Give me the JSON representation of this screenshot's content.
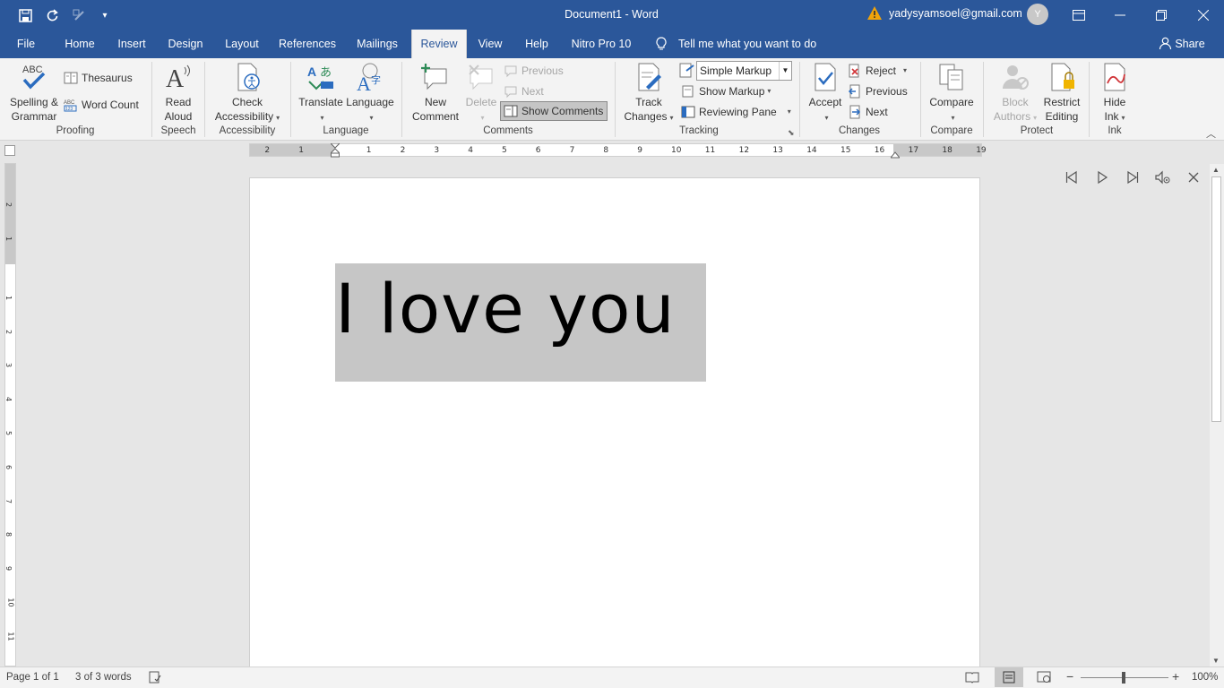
{
  "titlebar": {
    "doc_title": "Document1  -  Word",
    "account": "yadysyamsoel@gmail.com",
    "avatar_initial": "Y"
  },
  "tabs": [
    {
      "label": "File"
    },
    {
      "label": "Home"
    },
    {
      "label": "Insert"
    },
    {
      "label": "Design"
    },
    {
      "label": "Layout"
    },
    {
      "label": "References"
    },
    {
      "label": "Mailings"
    },
    {
      "label": "Review",
      "active": true
    },
    {
      "label": "View"
    },
    {
      "label": "Help"
    },
    {
      "label": "Nitro Pro 10"
    }
  ],
  "tell_me": "Tell me what you want to do",
  "share": "Share",
  "ribbon": {
    "proofing": {
      "spelling": "Spelling &",
      "spelling2": "Grammar",
      "thesaurus": "Thesaurus",
      "word_count": "Word Count",
      "label": "Proofing"
    },
    "speech": {
      "read": "Read",
      "read2": "Aloud",
      "label": "Speech"
    },
    "accessibility": {
      "check": "Check",
      "check2": "Accessibility",
      "label": "Accessibility"
    },
    "language": {
      "translate": "Translate",
      "language": "Language",
      "label": "Language"
    },
    "comments": {
      "new": "New",
      "new2": "Comment",
      "delete": "Delete",
      "previous": "Previous",
      "next": "Next",
      "show": "Show Comments",
      "label": "Comments"
    },
    "tracking": {
      "track": "Track",
      "track2": "Changes",
      "markup": "Simple Markup",
      "show_markup": "Show Markup",
      "reviewing_pane": "Reviewing Pane",
      "label": "Tracking"
    },
    "changes": {
      "accept": "Accept",
      "reject": "Reject",
      "previous": "Previous",
      "next": "Next",
      "label": "Changes"
    },
    "compare": {
      "compare": "Compare",
      "label": "Compare"
    },
    "protect": {
      "block": "Block",
      "block2": "Authors",
      "restrict": "Restrict",
      "restrict2": "Editing",
      "label": "Protect"
    },
    "ink": {
      "hide": "Hide",
      "hide2": "Ink",
      "label": "Ink"
    }
  },
  "ruler_ticks": [
    "2",
    "1",
    "1",
    "2",
    "3",
    "4",
    "5",
    "6",
    "7",
    "8",
    "9",
    "10",
    "11",
    "12",
    "13",
    "14",
    "15",
    "16",
    "17",
    "18",
    "19"
  ],
  "vruler_ticks": [
    "2",
    "1",
    "1",
    "2",
    "3",
    "4",
    "5",
    "6",
    "7",
    "8",
    "9",
    "10",
    "11"
  ],
  "document": {
    "text": "I love you"
  },
  "status": {
    "page": "Page 1 of 1",
    "words": "3 of 3 words",
    "zoom": "100%"
  },
  "colors": {
    "brand": "#2b579a",
    "selection": "#c6c6c6"
  }
}
